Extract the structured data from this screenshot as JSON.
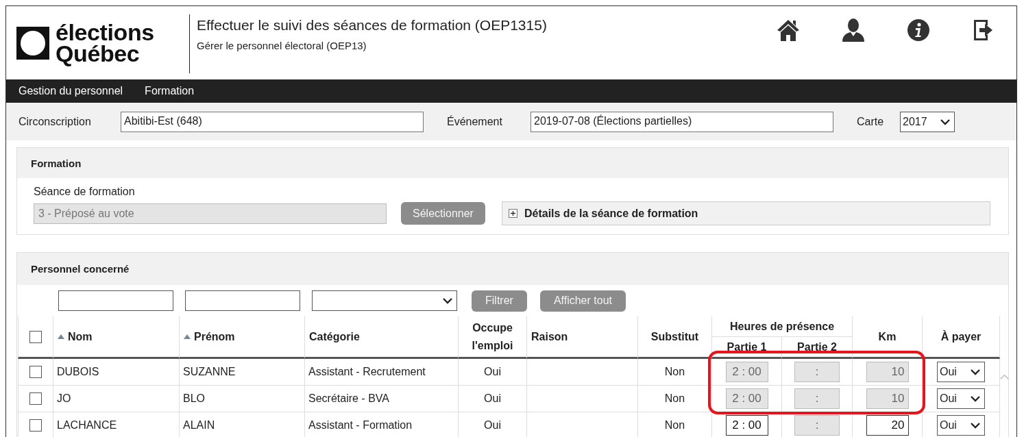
{
  "header": {
    "logo": {
      "line_1": "élections",
      "line_2": "Québec"
    },
    "title": "Effectuer le suivi des séances de formation (OEP1315)",
    "subtitle": "Gérer le personnel électoral (OEP13)"
  },
  "menu": [
    "Gestion du personnel",
    "Formation"
  ],
  "context": {
    "fields": [
      {
        "label": "Circonscription",
        "value": "Abitibi-Est (648)",
        "kind": "text"
      },
      {
        "label": "Événement",
        "value": "2019-07-08 (Élections partielles)",
        "kind": "text"
      },
      {
        "label": "Carte",
        "value": "2017",
        "kind": "select"
      }
    ]
  },
  "formation": {
    "title": "Formation",
    "session_label": "Séance de formation",
    "session_value": "3 - Préposé au vote",
    "session_disabled": true,
    "select_button": {
      "label": "Sélectionner",
      "disabled": true
    },
    "details": {
      "label": "Détails de la séance de formation",
      "expanded": false
    }
  },
  "personnel": {
    "title": "Personnel concerné",
    "filters": [
      {
        "kind": "text"
      },
      {
        "kind": "text"
      },
      {
        "kind": "select"
      }
    ],
    "buttons": [
      {
        "label": "Filtrer",
        "disabled": true
      },
      {
        "label": "Afficher tout",
        "disabled": true
      }
    ],
    "table": {
      "select_all_checked": false,
      "columns": [
        {
          "kind": "sortable",
          "label": "Nom",
          "sort_ascending": true
        },
        {
          "kind": "sortable",
          "label": "Prénom",
          "sort_ascending": true
        },
        {
          "kind": "plain",
          "label": "Catégorie"
        },
        {
          "kind": "center",
          "label": "Occupe l'emploi"
        },
        {
          "kind": "plain",
          "label": "Raison"
        },
        {
          "kind": "center",
          "label": "Substitut"
        },
        {
          "kind": "group",
          "label": "Heures de présence",
          "children": [
            {
              "label": "Partie 1"
            },
            {
              "label": "Partie 2"
            }
          ]
        },
        {
          "kind": "center",
          "label": "Km"
        },
        {
          "kind": "center",
          "label": "À payer"
        }
      ],
      "rows": [
        {
          "checked": false,
          "nom": "DUBOIS",
          "prenom": "SUZANNE",
          "categorie": "Assistant - Recrutement",
          "occupe": "Oui",
          "substitut": "Non",
          "partie_1": {
            "time": "2 : 00",
            "disabled": true
          },
          "partie_2": {
            "time": ":",
            "disabled": true
          },
          "km": {
            "value": "10",
            "disabled": true
          },
          "a_payer": "Oui",
          "highlighted": true
        },
        {
          "checked": false,
          "nom": "JO",
          "prenom": "BLO",
          "categorie": "Secrétaire - BVA",
          "occupe": "Oui",
          "substitut": "Non",
          "partie_1": {
            "time": "2 : 00",
            "disabled": true
          },
          "partie_2": {
            "time": ":",
            "disabled": true
          },
          "km": {
            "value": "10",
            "disabled": true
          },
          "a_payer": "Oui",
          "highlighted": true
        },
        {
          "checked": false,
          "nom": "LACHANCE",
          "prenom": "ALAIN",
          "categorie": "Assistant - Formation",
          "occupe": "Oui",
          "substitut": "Non",
          "partie_1": {
            "time": "2 : 00",
            "disabled": false
          },
          "partie_2": {
            "time": ":",
            "disabled": true
          },
          "km": {
            "value": "20",
            "disabled": false
          },
          "a_payer": "Oui",
          "highlighted": false
        }
      ]
    }
  }
}
